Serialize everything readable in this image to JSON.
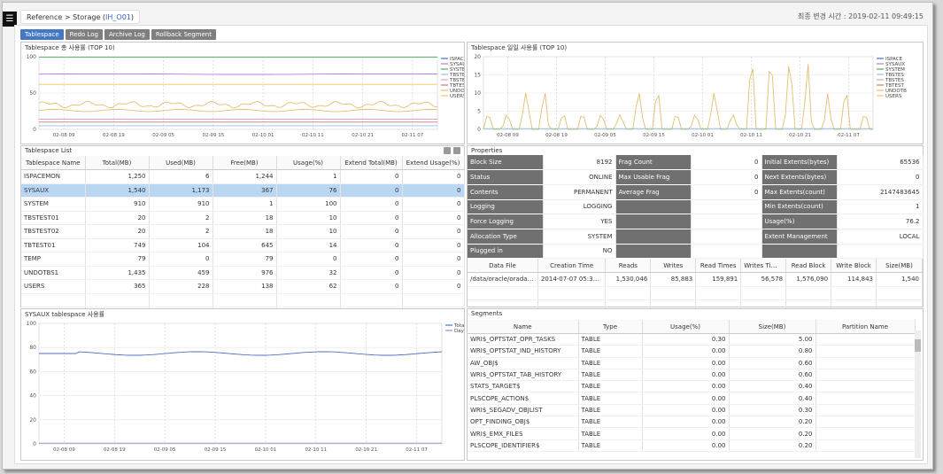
{
  "breadcrumb": {
    "parent": "Reference > Storage (",
    "current": "IH_O01",
    "close": ")"
  },
  "last_update": "최종 변경 시간 : 2019-02-11 09:49:15",
  "tabs": [
    "Tablespace",
    "Redo Log",
    "Archive Log",
    "Rollback Segment"
  ],
  "total_usage_chart": {
    "title": "Tablespace 총 사용률 (TOP 10)",
    "type": "line",
    "ylim": [
      0,
      100
    ],
    "yticks": [
      0,
      50,
      100
    ],
    "x": [
      "02-08 09",
      "02-08 19",
      "02-09 05",
      "02-09 15",
      "02-10 01",
      "02-10 11",
      "02-10 21",
      "02-11 07"
    ],
    "legend": [
      "ISPACE",
      "SYSAUX",
      "SYSTEM",
      "TBSTES",
      "TBSTES",
      "TBTEST",
      "UNDOTB",
      "USERS"
    ],
    "legend_colors": [
      "#4a6fc3",
      "#b07fd9",
      "#4cae58",
      "#8fc0e6",
      "#e0a0c8",
      "#e07070",
      "#e0c070",
      "#f0c860"
    ],
    "series": [
      {
        "name": "SYSAUX",
        "approx": 76
      },
      {
        "name": "SYSTEM",
        "approx": 100
      },
      {
        "name": "UNDOTB",
        "approx": 30
      },
      {
        "name": "USERS",
        "approx": 62
      },
      {
        "name": "TBTEST",
        "approx": 10
      }
    ]
  },
  "daily_usage_chart": {
    "title": "Tablespace 일일 사용률 (TOP 10)",
    "type": "line",
    "ylim": [
      0,
      20
    ],
    "yticks": [
      0,
      5,
      10,
      15,
      20
    ],
    "x": [
      "02-08 09",
      "02-08 19",
      "02-09 05",
      "02-09 15",
      "02-10 01",
      "02-10 11",
      "02-10 21",
      "02-11 07"
    ],
    "legend": [
      "ISPACE",
      "SYSAUX",
      "SYSTEM",
      "TBSTES",
      "TBSTES",
      "TBTEST",
      "UNDOTB",
      "USERS"
    ]
  },
  "tablespace_list": {
    "title": "Tablespace List",
    "columns": [
      "Tablespace Name",
      "Total(MB)",
      "Used(MB)",
      "Free(MB)",
      "Usage(%)",
      "Extend Total(MB)",
      "Extend Usage(%)"
    ],
    "rows": [
      [
        "ISPACEMON",
        "1,250",
        "6",
        "1,244",
        "1",
        "0",
        "0"
      ],
      [
        "SYSAUX",
        "1,540",
        "1,173",
        "367",
        "76",
        "0",
        "0"
      ],
      [
        "SYSTEM",
        "910",
        "910",
        "1",
        "100",
        "0",
        "0"
      ],
      [
        "TBSTEST01",
        "20",
        "2",
        "18",
        "10",
        "0",
        "0"
      ],
      [
        "TBSTEST02",
        "20",
        "2",
        "18",
        "10",
        "0",
        "0"
      ],
      [
        "TBTEST01",
        "749",
        "104",
        "645",
        "14",
        "0",
        "0"
      ],
      [
        "TEMP",
        "79",
        "0",
        "79",
        "0",
        "0",
        "0"
      ],
      [
        "UNDOTBS1",
        "1,435",
        "459",
        "976",
        "32",
        "0",
        "0"
      ],
      [
        "USERS",
        "365",
        "228",
        "138",
        "62",
        "0",
        "0"
      ]
    ],
    "selected": 1
  },
  "properties": {
    "title": "Properties",
    "rows": [
      [
        "Block Size",
        "8192",
        "Frag Count",
        "0",
        "Initial Extents(bytes)",
        "65536"
      ],
      [
        "Status",
        "ONLINE",
        "Max Usable Frag",
        "0",
        "Next Extents(bytes)",
        "0"
      ],
      [
        "Contents",
        "PERMANENT",
        "Average Frag",
        "0",
        "Max Extents(count)",
        "2147483645"
      ],
      [
        "Logging",
        "LOGGING",
        "",
        "",
        "Min Extents(count)",
        "1"
      ],
      [
        "Force Logging",
        "YES",
        "",
        "",
        "Usage(%)",
        "76.2"
      ],
      [
        "Allocation Type",
        "SYSTEM",
        "",
        "",
        "Extent Management",
        "LOCAL"
      ],
      [
        "Plugged in",
        "NO",
        "",
        "",
        "",
        ""
      ]
    ]
  },
  "datafile": {
    "columns": [
      "Data File",
      "Creation Time",
      "Reads",
      "Writes",
      "Read Times",
      "Writes Times",
      "Read Block",
      "Write Block",
      "Size(MB)"
    ],
    "rows": [
      [
        "/data/oracle/oradata···",
        "2014-07-07 05:39:05",
        "1,530,046",
        "85,883",
        "159,891",
        "56,578",
        "1,576,090",
        "114,843",
        "1,540"
      ]
    ]
  },
  "sysaux_chart": {
    "title": "SYSAUX tablespace 사용률",
    "type": "line",
    "ylim": [
      0,
      100
    ],
    "yticks": [
      0,
      20,
      40,
      60,
      80,
      100
    ],
    "x": [
      "02-08 09",
      "02-08 19",
      "02-09 05",
      "02-09 15",
      "02-10 01",
      "02-10 11",
      "02-10 21",
      "02-11 07"
    ],
    "legend": [
      "Total",
      "Day"
    ],
    "series": [
      {
        "name": "Total",
        "approx": 76
      },
      {
        "name": "Day",
        "approx": 0.5
      }
    ]
  },
  "segments": {
    "title": "Segments",
    "columns": [
      "Name",
      "Type",
      "Usage(%)",
      "Size(MB)",
      "Partition Name"
    ],
    "rows": [
      [
        "WRI$_OPTSTAT_OPR_TASKS",
        "TABLE",
        "0.30",
        "5.00",
        ""
      ],
      [
        "WRI$_OPTSTAT_IND_HISTORY",
        "TABLE",
        "0.00",
        "0.80",
        ""
      ],
      [
        "AW_OBJ$",
        "TABLE",
        "0.00",
        "0.60",
        ""
      ],
      [
        "WRI$_OPTSTAT_TAB_HISTORY",
        "TABLE",
        "0.00",
        "0.60",
        ""
      ],
      [
        "STATS_TARGET$",
        "TABLE",
        "0.00",
        "0.40",
        ""
      ],
      [
        "PLSCOPE_ACTION$",
        "TABLE",
        "0.00",
        "0.40",
        ""
      ],
      [
        "WRI$_SEGADV_OBJLIST",
        "TABLE",
        "0.00",
        "0.30",
        ""
      ],
      [
        "OPT_FINDING_OBJ$",
        "TABLE",
        "0.00",
        "0.20",
        ""
      ],
      [
        "WRI$_EMX_FILES",
        "TABLE",
        "0.00",
        "0.20",
        ""
      ],
      [
        "PLSCOPE_IDENTIFIER$",
        "TABLE",
        "0.00",
        "0.20",
        ""
      ]
    ]
  }
}
